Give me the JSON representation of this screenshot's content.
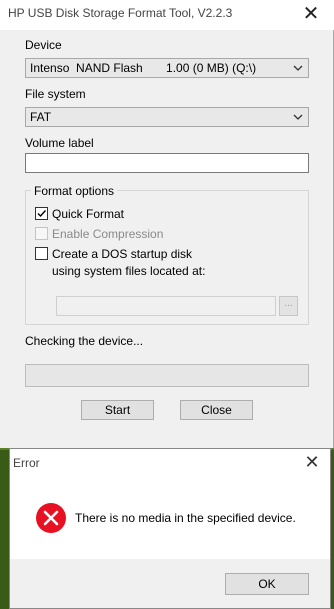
{
  "main_window": {
    "title": "HP USB Disk Storage Format Tool, V2.2.3",
    "close_glyph": "✕",
    "device": {
      "label": "Device",
      "selected": "Intenso  NAND Flash       1.00 (0 MB) (Q:\\)"
    },
    "file_system": {
      "label": "File system",
      "selected": "FAT"
    },
    "volume_label": {
      "label": "Volume label",
      "value": ""
    },
    "format_options": {
      "title": "Format options",
      "quick_format": {
        "label": "Quick Format",
        "checked": true,
        "enabled": true
      },
      "enable_compression": {
        "label": "Enable Compression",
        "checked": false,
        "enabled": false
      },
      "dos_startup": {
        "label": "Create a DOS startup disk",
        "checked": false,
        "enabled": true
      },
      "system_files_label": "using system files located at:",
      "path_value": "",
      "browse_label": "..."
    },
    "status_text": "Checking the device...",
    "progress_percent": 0,
    "start_button": "Start",
    "close_button": "Close"
  },
  "error_dialog": {
    "title": "Error",
    "close_glyph": "✕",
    "message": "There is no media in the specified device.",
    "icon": "error-icon",
    "ok_button": "OK"
  },
  "colors": {
    "error_red": "#e81123",
    "progress_green": "#06b025"
  }
}
